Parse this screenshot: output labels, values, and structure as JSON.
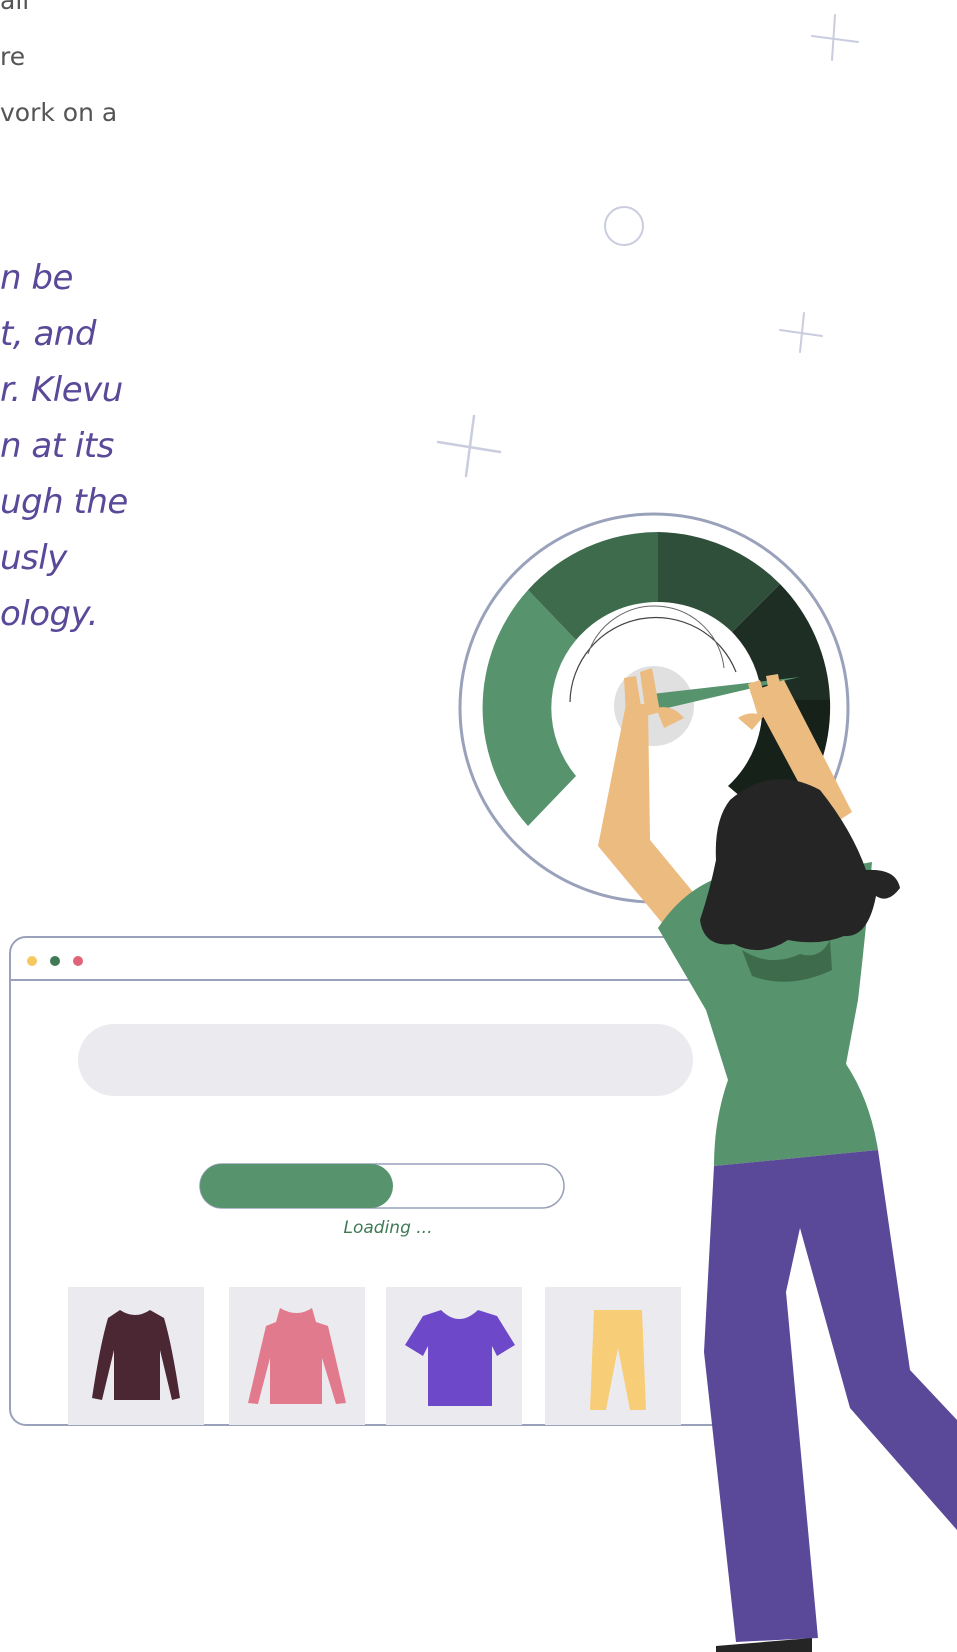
{
  "intro_text": {
    "lines": [
      "all",
      "re",
      "vork on a"
    ]
  },
  "quote_text": {
    "lines": [
      "n be",
      "t, and",
      "r. Klevu",
      "n at its",
      "ugh the",
      "usly",
      "ology."
    ]
  },
  "illustration": {
    "loading_label": "Loading ...",
    "progress": 0.53,
    "window_dots": [
      "#f6c85f",
      "#3f7a55",
      "#e0637a"
    ],
    "products": [
      {
        "name": "long-sleeve-top",
        "color": "#4a2733"
      },
      {
        "name": "cold-shoulder-top",
        "color": "#e27a8d"
      },
      {
        "name": "t-shirt",
        "color": "#6d48c9"
      },
      {
        "name": "trousers",
        "color": "#f8cd78"
      }
    ],
    "colors": {
      "accent_green": "#57936d",
      "dark_green": "#2f4f3a",
      "purple": "#5a4898",
      "skin": "#ecbb80",
      "hair": "#252525"
    }
  }
}
